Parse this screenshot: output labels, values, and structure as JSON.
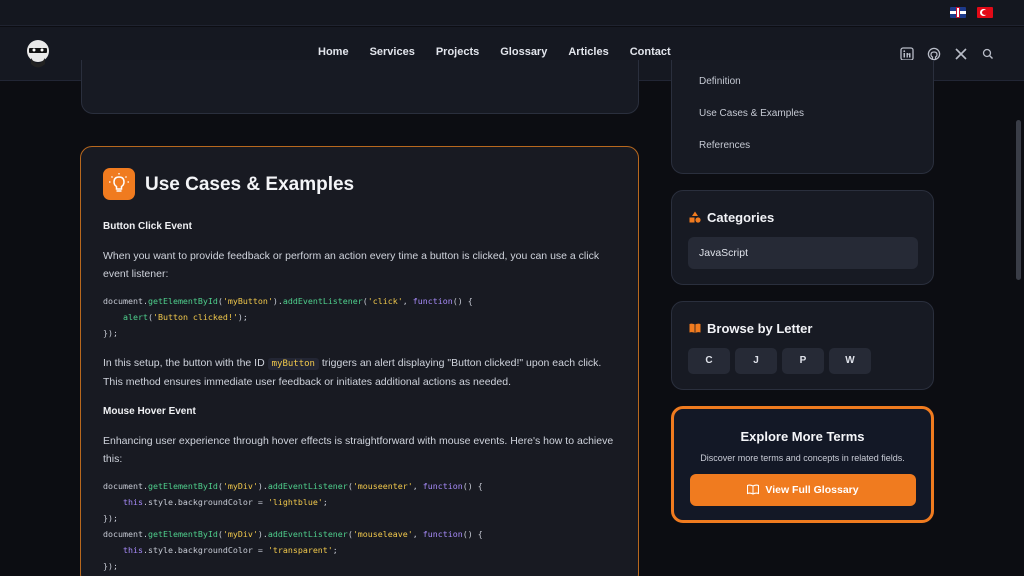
{
  "languages": [
    "english-flag-icon",
    "turkish-flag-icon"
  ],
  "nav": {
    "links": [
      "Home",
      "Services",
      "Projects",
      "Glossary",
      "Articles",
      "Contact"
    ],
    "icons": [
      "linkedin-icon",
      "github-icon",
      "x-icon",
      "search-icon"
    ]
  },
  "main": {
    "title": "Use Cases & Examples",
    "section1": {
      "heading": "Button Click Event",
      "intro": "When you want to provide feedback or perform an action every time a button is clicked, you can use a click event listener:",
      "explain_before": "In this setup, the button with the ID",
      "inline_code": "myButton",
      "explain_after": "triggers an alert displaying \"Button clicked!\" upon each click. This method ensures immediate user feedback or initiates additional actions as needed."
    },
    "section2": {
      "heading": "Mouse Hover Event",
      "intro": "Enhancing user experience through hover effects is straightforward with mouse events. Here's how to achieve this:"
    }
  },
  "sidebar": {
    "toc": [
      "Definition",
      "Use Cases & Examples",
      "References"
    ],
    "categories_title": "Categories",
    "categories": [
      "JavaScript"
    ],
    "letters_title": "Browse by Letter",
    "letters": [
      "C",
      "J",
      "P",
      "W"
    ],
    "explore": {
      "title": "Explore More Terms",
      "subtitle": "Discover more terms and concepts in related fields.",
      "button": "View Full Glossary"
    }
  },
  "colors": {
    "accent": "#f07b1f",
    "code_fn": "#4fd08d",
    "code_str": "#f2c94c",
    "code_kw": "#a78bfa"
  }
}
